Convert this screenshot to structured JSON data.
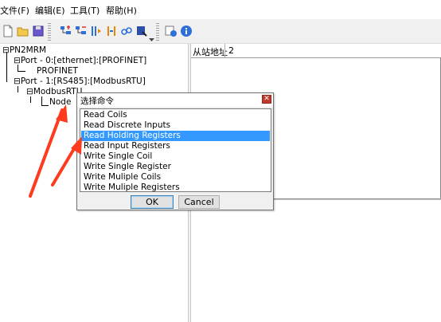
{
  "menu": [
    "文件(F)",
    "编辑(E)",
    "工具(T)",
    "帮助(H)"
  ],
  "toolbar_icons": [
    "new-file-icon",
    "open-folder-icon",
    "save-icon",
    "tree-add-icon",
    "tree-remove-icon",
    "move-icon",
    "transfer-icon",
    "link-icon",
    "export-icon",
    "settings-icon",
    "info-icon"
  ],
  "tree": {
    "root": "PN2MRM",
    "port0": "Port - 0:[ethernet]:[PROFINET]",
    "profinet": "PROFINET",
    "port1": "Port - 1:[RS485]:[ModbusRTU]",
    "modbus": "ModbusRTU",
    "node": "Node"
  },
  "right": {
    "addr_label": "从站地址",
    "addr_value": "2"
  },
  "dialog": {
    "title": "选择命令",
    "close": "✕",
    "items": [
      "Read Coils",
      "Read Discrete Inputs",
      "Read Holding Registers",
      "Read Input Registers",
      "Write Single Coil",
      "Write Single Register",
      "Write Muliple Coils",
      "Write Muliple Registers"
    ],
    "selected_index": 2,
    "ok": "OK",
    "cancel": "Cancel"
  },
  "colors": {
    "selection": "#3399ff",
    "arrow": "#ff3b1f",
    "close": "#c0392b"
  }
}
